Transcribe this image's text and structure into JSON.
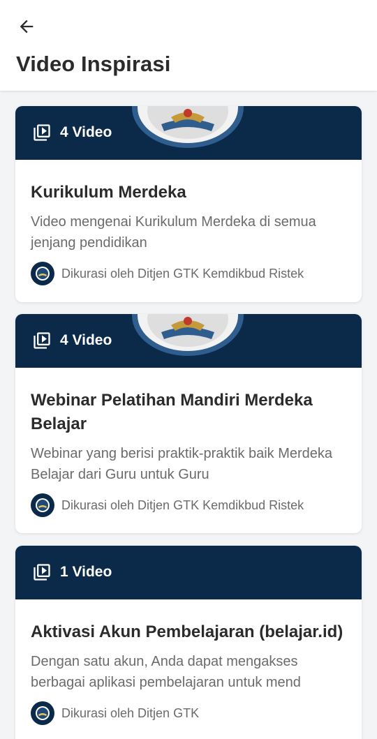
{
  "header": {
    "back_icon": "arrow-left-icon",
    "title": "Video Inspirasi"
  },
  "colors": {
    "banner": "#0b2a4a",
    "card": "#ffffff",
    "background": "#f3f4f6"
  },
  "cards": [
    {
      "video_count": "4 Video",
      "title": "Kurikulum Merdeka",
      "description": "Video mengenai Kurikulum Merdeka di semua jenjang pendidikan",
      "curator": "Dikurasi oleh Ditjen GTK Kemdikbud Ristek"
    },
    {
      "video_count": "4 Video",
      "title": "Webinar Pelatihan Mandiri Merdeka Belajar",
      "description": "Webinar yang berisi praktik-praktik baik Merdeka Belajar dari Guru untuk Guru",
      "curator": "Dikurasi oleh Ditjen GTK Kemdikbud Ristek"
    },
    {
      "video_count": "1 Video",
      "title": "Aktivasi Akun Pembelajaran (belajar.id)",
      "description": "Dengan satu akun, Anda dapat mengakses berbagai aplikasi pembelajaran untuk mend",
      "curator": "Dikurasi oleh Ditjen GTK"
    }
  ]
}
